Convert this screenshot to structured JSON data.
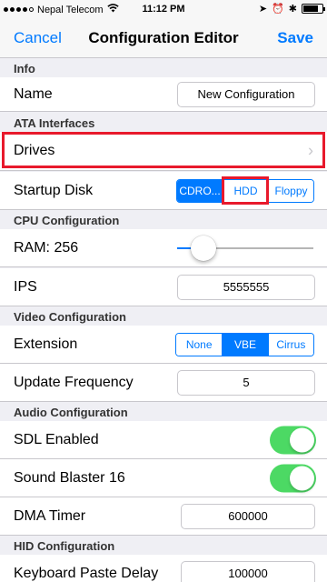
{
  "status_bar": {
    "carrier": "Nepal Telecom",
    "time": "11:12 PM"
  },
  "nav": {
    "cancel_label": "Cancel",
    "title": "Configuration Editor",
    "save_label": "Save"
  },
  "sections": {
    "info": "Info",
    "ata": "ATA Interfaces",
    "cpu": "CPU Configuration",
    "video": "Video Configuration",
    "audio": "Audio Configuration",
    "hid": "HID Configuration"
  },
  "rows": {
    "name": {
      "label": "Name",
      "value": "New Configuration"
    },
    "drives": {
      "label": "Drives",
      "chevron": "›"
    },
    "startup_disk": {
      "label": "Startup Disk",
      "options": [
        "CDRO...",
        "HDD",
        "Floppy"
      ],
      "selected": "CDRO..."
    },
    "ram": {
      "label": "RAM: 256",
      "slider_fraction": 0.19
    },
    "ips": {
      "label": "IPS",
      "value": "5555555"
    },
    "extension": {
      "label": "Extension",
      "options": [
        "None",
        "VBE",
        "Cirrus"
      ],
      "selected": "VBE"
    },
    "update_frequency": {
      "label": "Update Frequency",
      "value": "5"
    },
    "sdl_enabled": {
      "label": "SDL Enabled",
      "on": true
    },
    "sound_blaster": {
      "label": "Sound Blaster 16",
      "on": true
    },
    "dma_timer": {
      "label": "DMA Timer",
      "value": "600000"
    },
    "keyboard_paste_delay": {
      "label": "Keyboard Paste Delay",
      "value": "100000"
    }
  },
  "colors": {
    "accent": "#007aff",
    "toggle_on": "#4cd964",
    "highlight": "#e8192c"
  }
}
